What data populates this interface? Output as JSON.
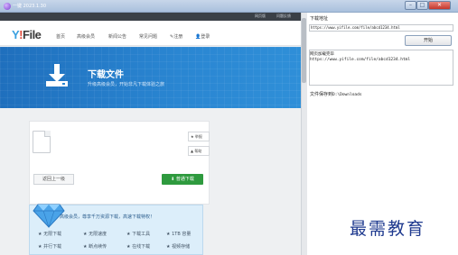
{
  "window": {
    "title": "一键 2023.1.30",
    "min_glyph": "–",
    "max_glyph": "□",
    "close_glyph": "✕"
  },
  "site": {
    "top_links": [
      "网页版",
      "问题反馈"
    ],
    "logo_y": "Y",
    "logo_i": "!",
    "logo_rest": "File",
    "nav": [
      "首页",
      "高级会员",
      "新闻公告",
      "常见问题",
      "注册",
      "登录"
    ],
    "banner_title": "下载文件",
    "banner_subtitle": "升级高级会员，开始非凡下载体验之旅",
    "report_label": "举报",
    "secondary_label": "帮助",
    "back_label": "返回上一级",
    "download_label": "普通下载",
    "vip_title": "高级会员，尊享千万资源下载，高速下载特权！",
    "vip_features": [
      "无限下载",
      "无限速度",
      "下载工具",
      "1TB 容量",
      "并行下载",
      "断点续传",
      "在线下载",
      "视频存储"
    ]
  },
  "panel": {
    "download_url_label": "下载地址",
    "download_url_value": "https://www.yifile.com/file/abcd1234.html",
    "start_label": "开始",
    "parse_label": "网页加载完毕",
    "parse_value": "https://www.yifile.com/file/abcd1234.html",
    "save_label": "文件保存到",
    "save_path": "D:\\Downloads"
  },
  "watermark": "最需教育",
  "colors": {
    "banner": "#2a86d2",
    "download_green": "#2e9a3e",
    "vip_bg": "#dceefa",
    "watermark": "#1f3a8f"
  }
}
